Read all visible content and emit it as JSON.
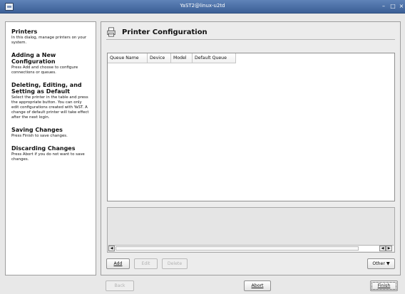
{
  "window": {
    "title": "YaST2@linux-u2td",
    "controls": [
      "–",
      "□",
      "×"
    ]
  },
  "help": [
    {
      "heading": "Printers",
      "text": "In this dialog, manage printers on your system."
    },
    {
      "heading": "Adding a New Configuration",
      "text": "Press Add and choose to configure connections or queues."
    },
    {
      "heading": "Deleting, Editing, and Setting as Default",
      "text": "Select the printer in the table and press the appropriate button. You can only edit configurations created with YaST. A change of default printer will take effect after the next login."
    },
    {
      "heading": "Saving Changes",
      "text": "Press Finish to save changes."
    },
    {
      "heading": "Discarding Changes",
      "text": "Press Abort if you do not want to save changes."
    }
  ],
  "main": {
    "title": "Printer Configuration",
    "columns": [
      "Queue Name",
      "Device",
      "Model",
      "Default Queue"
    ],
    "rows": []
  },
  "buttons": {
    "add": "Add",
    "edit": "Edit",
    "delete": "Delete",
    "other": "Other ▼",
    "back": "Back",
    "abort": "Abort",
    "finish": "Finish"
  },
  "icons": {
    "app": "yast-app-icon",
    "printer": "printer-icon"
  }
}
